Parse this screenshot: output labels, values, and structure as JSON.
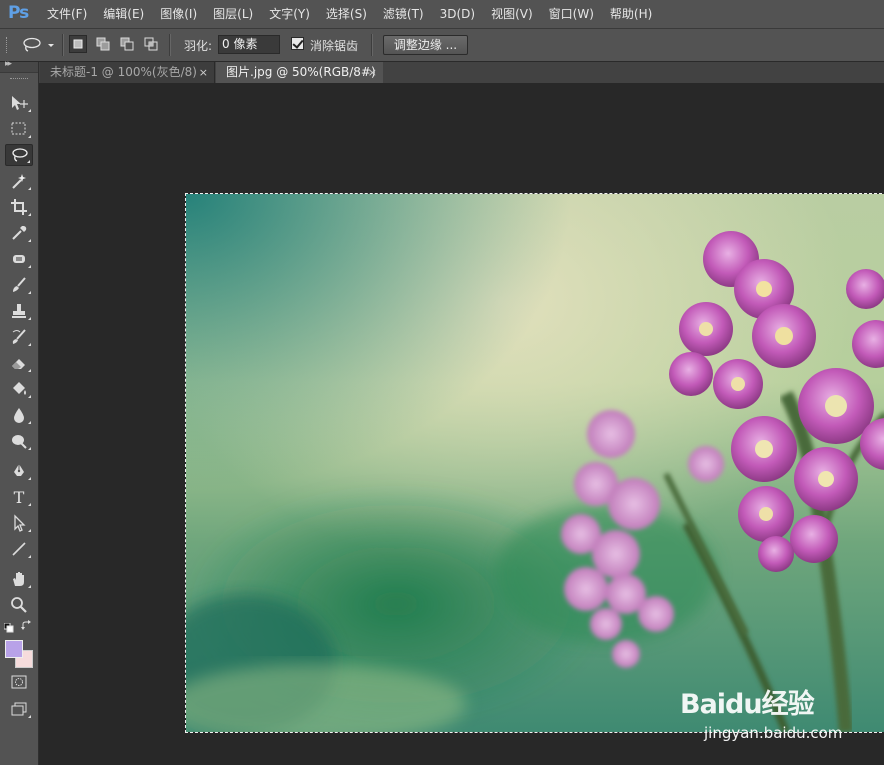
{
  "app": {
    "logo": "Ps"
  },
  "menu": [
    "文件(F)",
    "编辑(E)",
    "图像(I)",
    "图层(L)",
    "文字(Y)",
    "选择(S)",
    "滤镜(T)",
    "3D(D)",
    "视图(V)",
    "窗口(W)",
    "帮助(H)"
  ],
  "options": {
    "feather_label": "羽化:",
    "feather_value": "0 像素",
    "antialias_label": "消除锯齿",
    "antialias_checked": true,
    "refine_edge_label": "调整边缘 ..."
  },
  "tabs": [
    {
      "label": "未标题-1 @ 100%(灰色/8)",
      "active": false,
      "close": "×"
    },
    {
      "label": "图片.jpg @ 50%(RGB/8#)",
      "active": true,
      "close": "×"
    }
  ],
  "tools": [
    "move-tool",
    "marquee-tool",
    "lasso-tool",
    "magic-wand-tool",
    "crop-tool",
    "eyedropper-tool",
    "spot-healing-tool",
    "brush-tool",
    "clone-stamp-tool",
    "history-brush-tool",
    "eraser-tool",
    "paint-bucket-tool",
    "blur-tool",
    "dodge-tool",
    "pen-tool",
    "type-tool",
    "path-selection-tool",
    "line-tool",
    "hand-tool",
    "zoom-tool"
  ],
  "type_tool_glyph": "T",
  "colors": {
    "foreground": "#b8a2e8",
    "background": "#f6dcdc",
    "accent": "#5fa0e6"
  },
  "watermark": {
    "logo": "Bai⁠du经验",
    "url": "jingyan.baidu.com"
  }
}
